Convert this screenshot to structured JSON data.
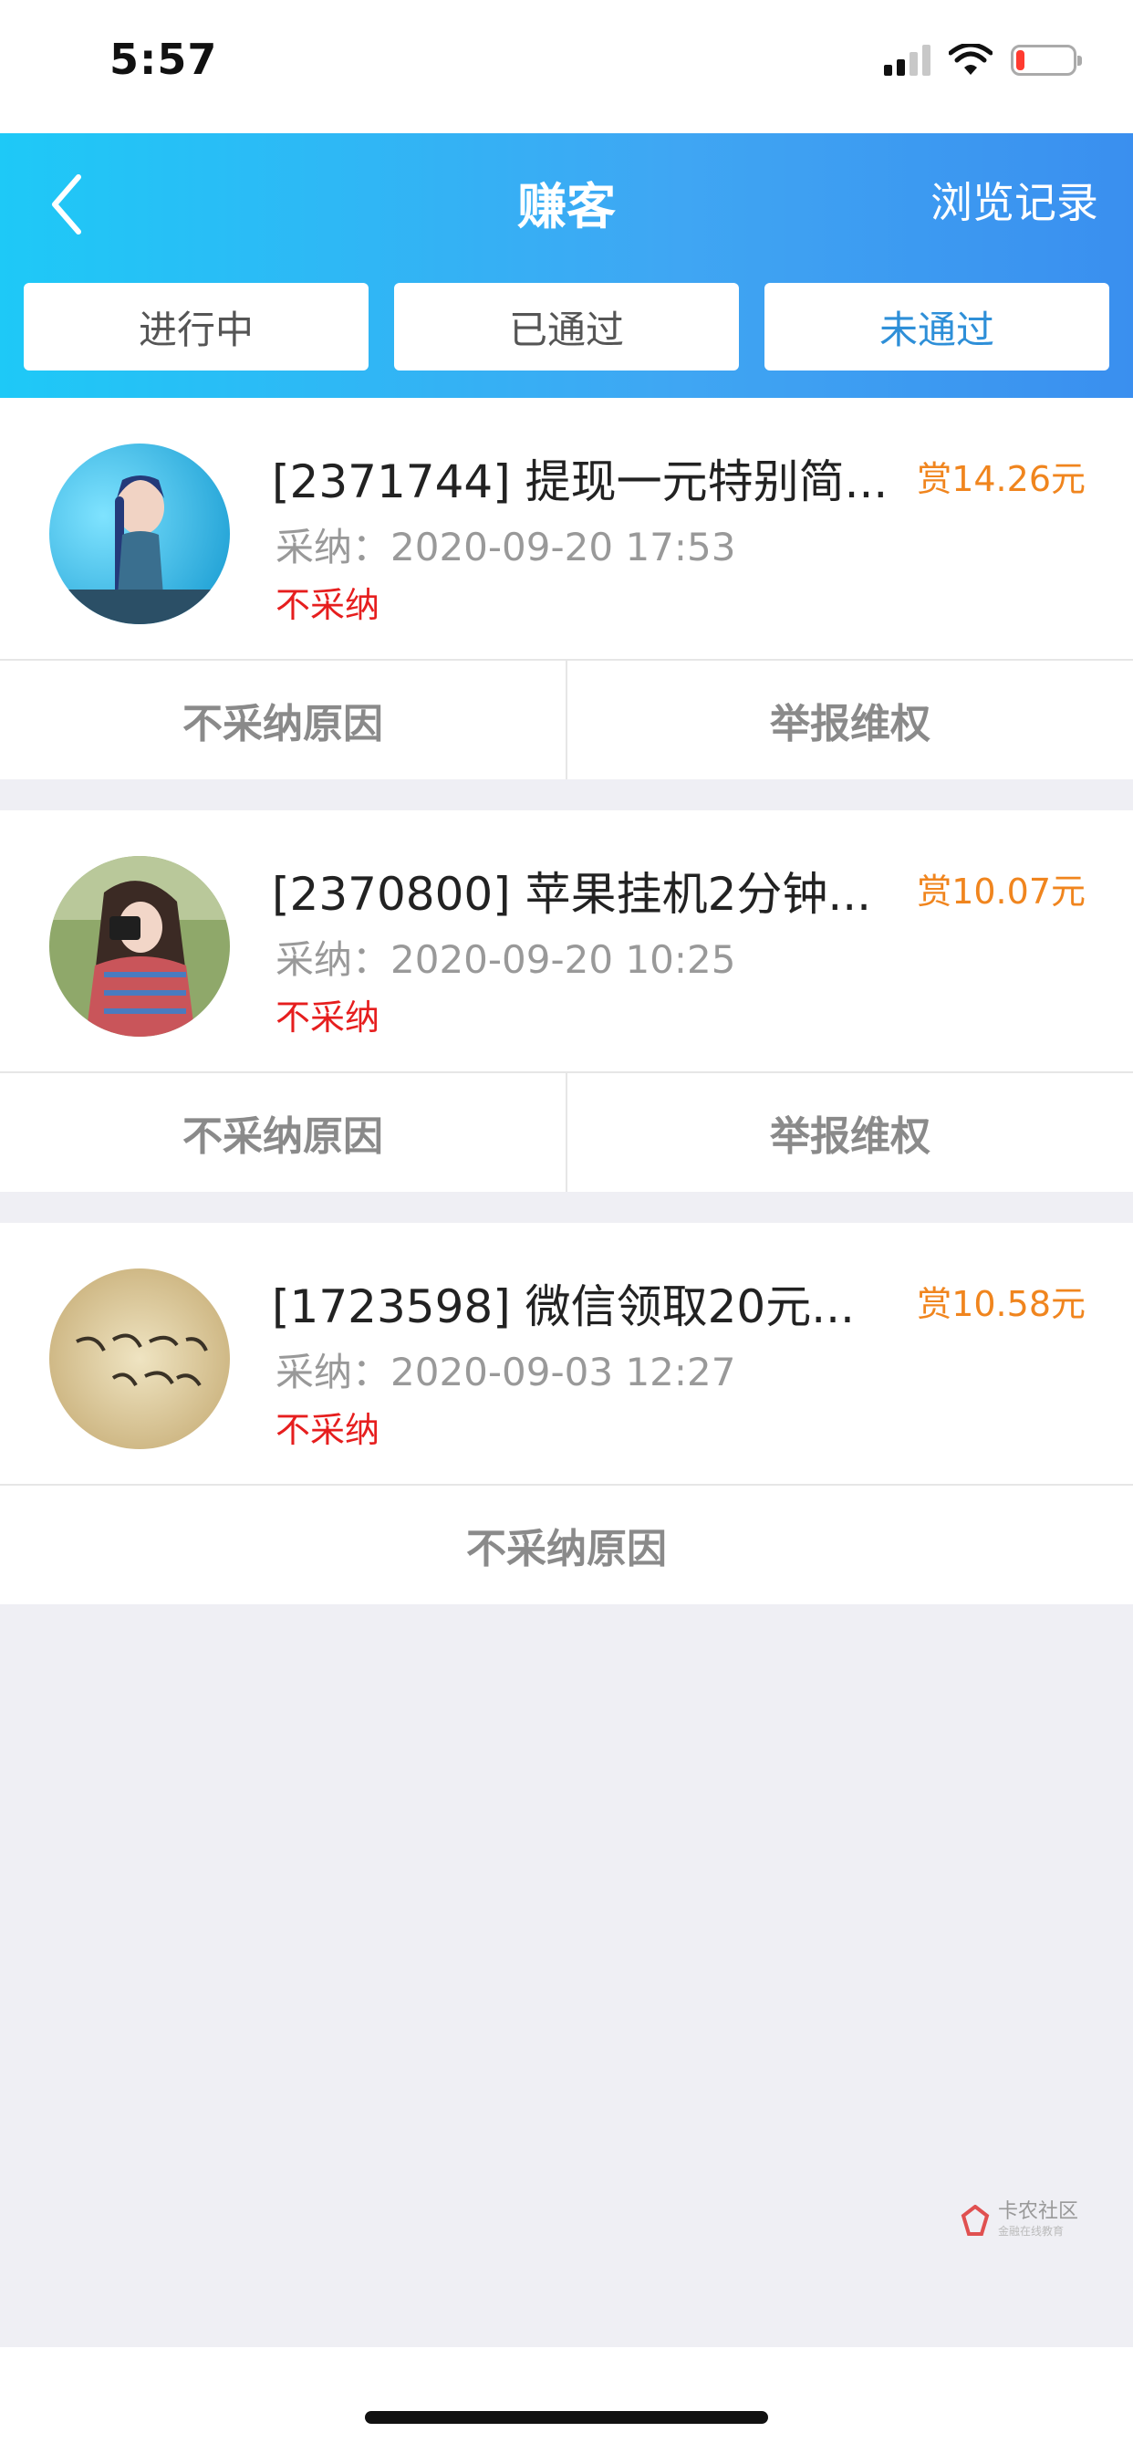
{
  "status_bar": {
    "time": "5:57",
    "battery_level": 0.15
  },
  "header": {
    "title": "赚客",
    "history_label": "浏览记录"
  },
  "tabs": [
    {
      "label": "进行中",
      "active": false
    },
    {
      "label": "已通过",
      "active": false
    },
    {
      "label": "未通过",
      "active": true
    }
  ],
  "tasks": [
    {
      "title": "[2371744] 提现一元特别简...",
      "reward": "赏14.26元",
      "time_label": "采纳：",
      "time_value": "2020-09-20 17:53",
      "status": "不采纳",
      "actions": [
        "不采纳原因",
        "举报维权"
      ]
    },
    {
      "title": "[2370800] 苹果挂机2分钟...",
      "reward": "赏10.07元",
      "time_label": "采纳：",
      "time_value": "2020-09-20 10:25",
      "status": "不采纳",
      "actions": [
        "不采纳原因",
        "举报维权"
      ]
    },
    {
      "title": "[1723598] 微信领取20元...",
      "reward": "赏10.58元",
      "time_label": "采纳：",
      "time_value": "2020-09-03 12:27",
      "status": "不采纳",
      "actions": [
        "不采纳原因"
      ]
    }
  ],
  "watermark": {
    "text": "卡农社区",
    "sub": "金融在线教育"
  },
  "colors": {
    "accent": "#2E8FD8",
    "reward": "#F0851E",
    "reject": "#E61E1E",
    "header_start": "#1EC9F7",
    "header_end": "#3A8FEF"
  }
}
